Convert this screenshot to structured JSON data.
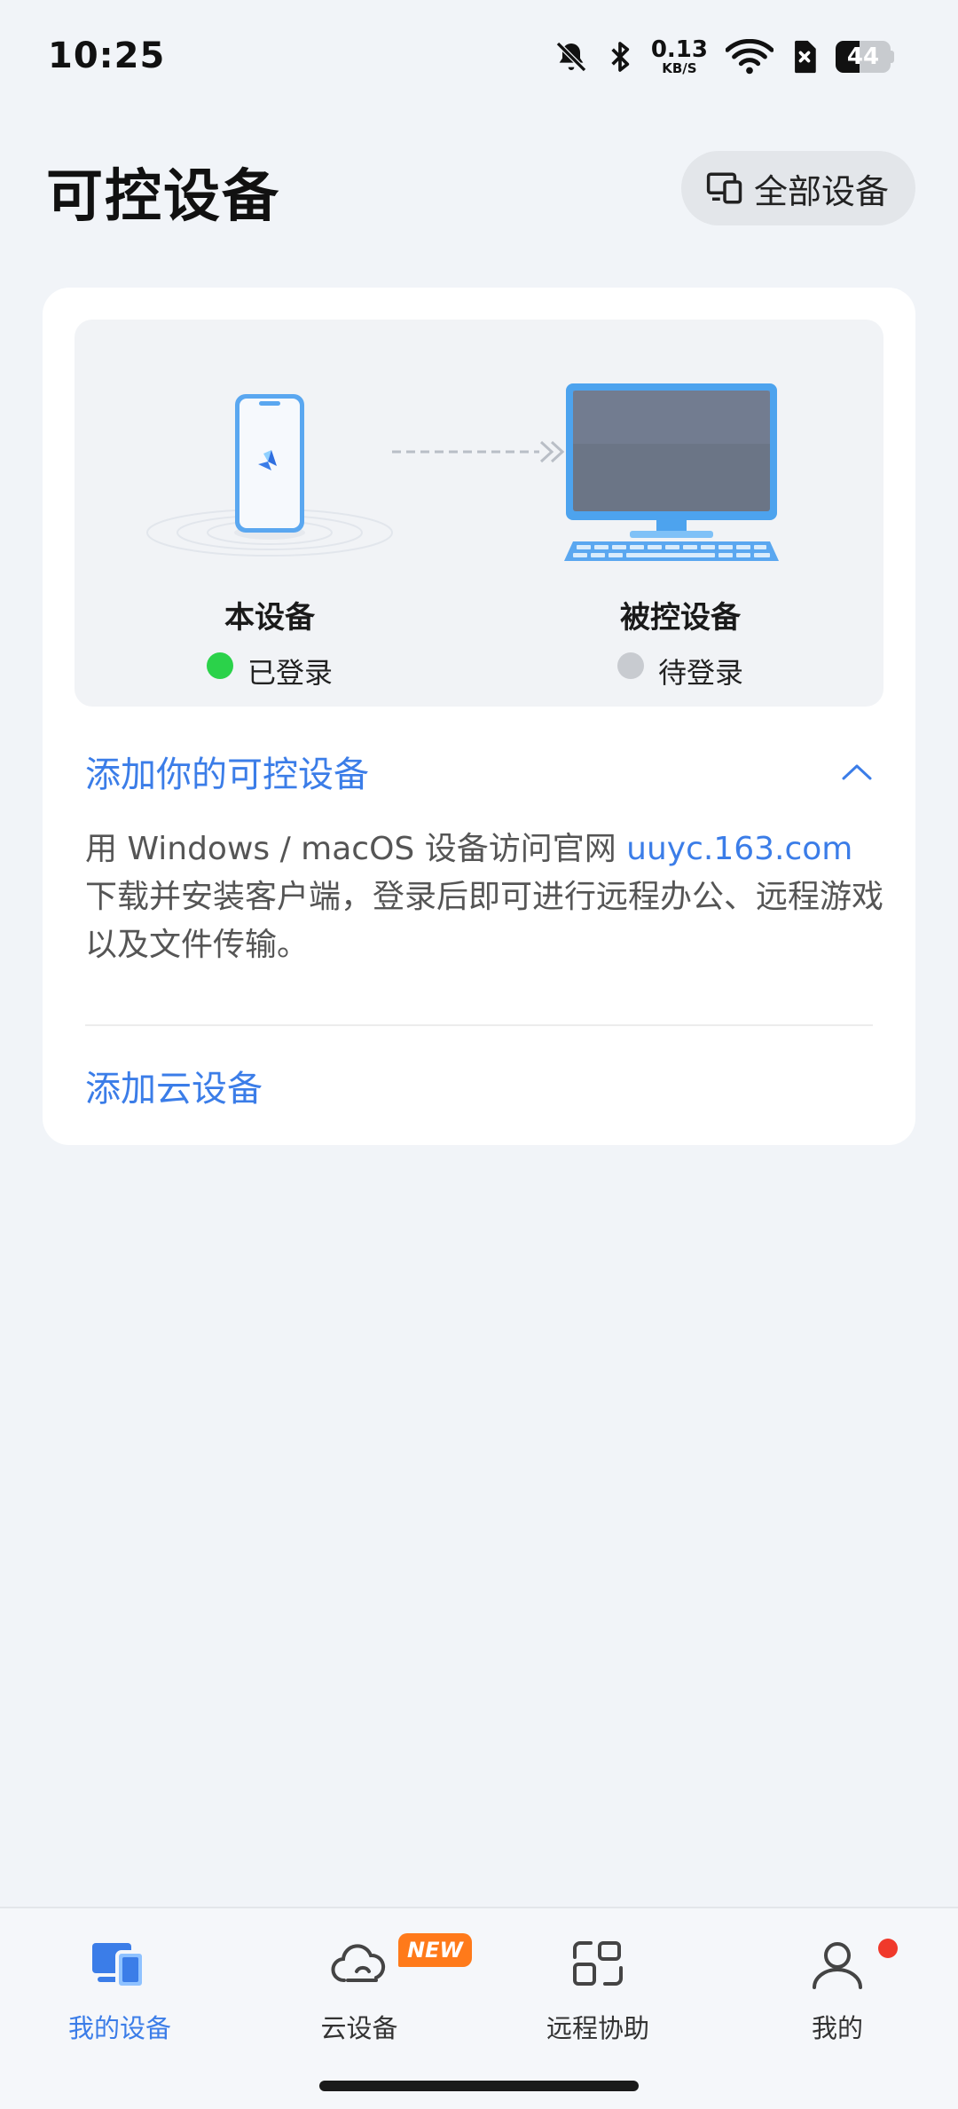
{
  "status_bar": {
    "time": "10:25",
    "net_speed_value": "0.13",
    "net_speed_unit": "KB/S",
    "battery_level": "44",
    "battery_fraction": 0.44,
    "icons": [
      "bell-off-icon",
      "bluetooth-icon",
      "wifi-icon",
      "sim-off-icon",
      "battery-icon"
    ]
  },
  "header": {
    "title": "可控设备",
    "all_devices_label": "全部设备"
  },
  "diagram": {
    "local": {
      "name": "本设备",
      "status": "已登录",
      "status_color": "#2bd24a"
    },
    "remote": {
      "name": "被控设备",
      "status": "待登录",
      "status_color": "#c8cbd0"
    }
  },
  "add_section": {
    "title": "添加你的可控设备",
    "desc_prefix": "用 Windows / macOS 设备访问官网 ",
    "desc_link": "uuyc.163.com",
    "desc_suffix": "下载并安装客户端，登录后即可进行远程办公、远程游戏以及文件传输。",
    "add_cloud_label": "添加云设备"
  },
  "bottom_nav": {
    "items": [
      {
        "label": "我的设备",
        "icon": "devices-icon",
        "active": true
      },
      {
        "label": "云设备",
        "icon": "cloud-icon",
        "badge": "NEW"
      },
      {
        "label": "远程协助",
        "icon": "remote-assist-icon"
      },
      {
        "label": "我的",
        "icon": "profile-icon",
        "dot": true
      }
    ]
  },
  "colors": {
    "accent": "#3b7de8",
    "badge": "#ff7a1a",
    "notify": "#f0392b"
  }
}
